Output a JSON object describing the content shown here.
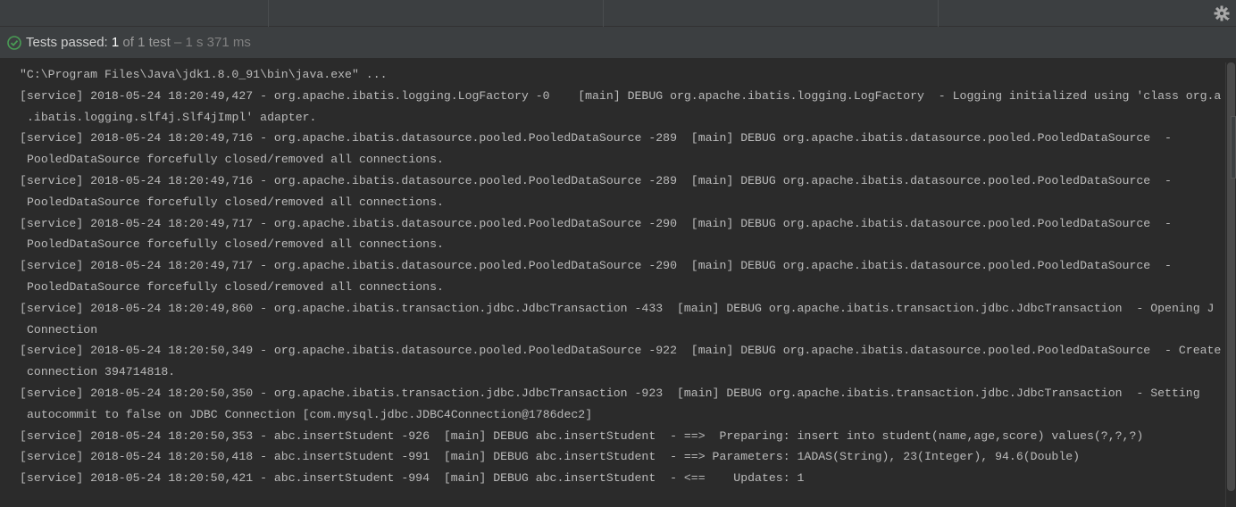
{
  "toolbar": {
    "gear_icon": "gear-icon"
  },
  "status": {
    "icon": "check-circle-icon",
    "status_color": "#499c54",
    "passed_label": "Tests passed:",
    "count": "1",
    "of_text": "of 1 test",
    "time_text": "– 1 s 371 ms"
  },
  "console": {
    "lines": [
      "\"C:\\Program Files\\Java\\jdk1.8.0_91\\bin\\java.exe\" ...",
      "[service] 2018-05-24 18:20:49,427 - org.apache.ibatis.logging.LogFactory -0    [main] DEBUG org.apache.ibatis.logging.LogFactory  - Logging initialized using 'class org.a",
      ".ibatis.logging.slf4j.Slf4jImpl' adapter.",
      "[service] 2018-05-24 18:20:49,716 - org.apache.ibatis.datasource.pooled.PooledDataSource -289  [main] DEBUG org.apache.ibatis.datasource.pooled.PooledDataSource  -",
      "PooledDataSource forcefully closed/removed all connections.",
      "[service] 2018-05-24 18:20:49,716 - org.apache.ibatis.datasource.pooled.PooledDataSource -289  [main] DEBUG org.apache.ibatis.datasource.pooled.PooledDataSource  -",
      "PooledDataSource forcefully closed/removed all connections.",
      "[service] 2018-05-24 18:20:49,717 - org.apache.ibatis.datasource.pooled.PooledDataSource -290  [main] DEBUG org.apache.ibatis.datasource.pooled.PooledDataSource  -",
      "PooledDataSource forcefully closed/removed all connections.",
      "[service] 2018-05-24 18:20:49,717 - org.apache.ibatis.datasource.pooled.PooledDataSource -290  [main] DEBUG org.apache.ibatis.datasource.pooled.PooledDataSource  -",
      "PooledDataSource forcefully closed/removed all connections.",
      "[service] 2018-05-24 18:20:49,860 - org.apache.ibatis.transaction.jdbc.JdbcTransaction -433  [main] DEBUG org.apache.ibatis.transaction.jdbc.JdbcTransaction  - Opening J",
      "Connection",
      "[service] 2018-05-24 18:20:50,349 - org.apache.ibatis.datasource.pooled.PooledDataSource -922  [main] DEBUG org.apache.ibatis.datasource.pooled.PooledDataSource  - Create",
      "connection 394714818.",
      "[service] 2018-05-24 18:20:50,350 - org.apache.ibatis.transaction.jdbc.JdbcTransaction -923  [main] DEBUG org.apache.ibatis.transaction.jdbc.JdbcTransaction  - Setting",
      "autocommit to false on JDBC Connection [com.mysql.jdbc.JDBC4Connection@1786dec2]",
      "[service] 2018-05-24 18:20:50,353 - abc.insertStudent -926  [main] DEBUG abc.insertStudent  - ==>  Preparing: insert into student(name,age,score) values(?,?,?)",
      "[service] 2018-05-24 18:20:50,418 - abc.insertStudent -991  [main] DEBUG abc.insertStudent  - ==> Parameters: 1ADAS(String), 23(Integer), 94.6(Double)",
      "[service] 2018-05-24 18:20:50,421 - abc.insertStudent -994  [main] DEBUG abc.insertStudent  - <==    Updates: 1"
    ],
    "continuation": [
      false,
      false,
      true,
      false,
      true,
      false,
      true,
      false,
      true,
      false,
      true,
      false,
      true,
      false,
      true,
      false,
      true,
      false,
      false,
      false
    ]
  }
}
